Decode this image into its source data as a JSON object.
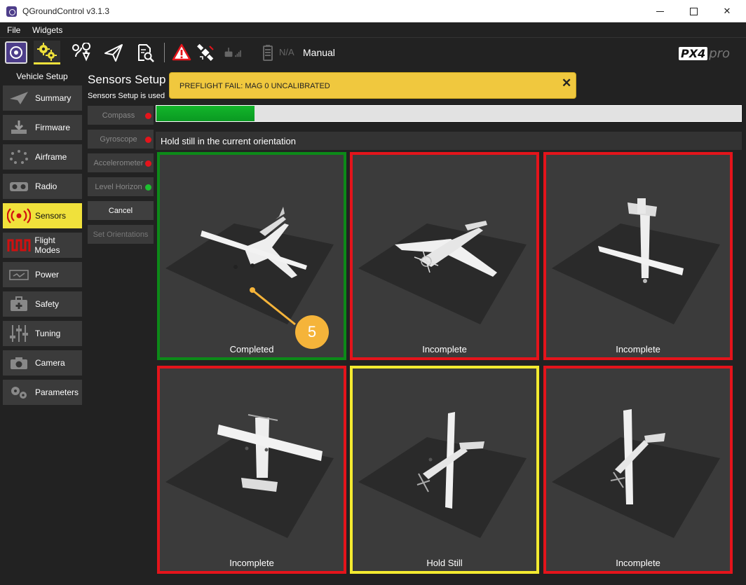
{
  "window": {
    "title": "QGroundControl v3.1.3"
  },
  "menu": {
    "file": "File",
    "widgets": "Widgets"
  },
  "toolbar": {
    "battery_text": "N/A",
    "flight_mode": "Manual",
    "brand_name": "PX4",
    "brand_suffix": "pro"
  },
  "sidebar": {
    "title": "Vehicle Setup",
    "items": [
      {
        "label": "Summary",
        "icon": "paper-plane-icon"
      },
      {
        "label": "Firmware",
        "icon": "download-icon"
      },
      {
        "label": "Airframe",
        "icon": "airframe-icon"
      },
      {
        "label": "Radio",
        "icon": "radio-icon"
      },
      {
        "label": "Sensors",
        "icon": "sensors-icon",
        "active": true
      },
      {
        "label": "Flight Modes",
        "icon": "flight-modes-icon"
      },
      {
        "label": "Power",
        "icon": "power-icon"
      },
      {
        "label": "Safety",
        "icon": "safety-icon"
      },
      {
        "label": "Tuning",
        "icon": "tuning-icon"
      },
      {
        "label": "Camera",
        "icon": "camera-icon"
      },
      {
        "label": "Parameters",
        "icon": "parameters-icon"
      }
    ]
  },
  "sensors": {
    "title": "Sensors Setup",
    "description": "Sensors Setup is used",
    "buttons": [
      {
        "label": "Compass",
        "status_color": "#e4141b"
      },
      {
        "label": "Gyroscope",
        "status_color": "#e4141b"
      },
      {
        "label": "Accelerometer",
        "status_color": "#e4141b"
      },
      {
        "label": "Level Horizon",
        "status_color": "#1ec030"
      }
    ],
    "cancel_label": "Cancel",
    "set_orientations_label": "Set Orientations"
  },
  "banner": {
    "message": "PREFLIGHT FAIL: MAG 0 UNCALIBRATED",
    "close": "✕"
  },
  "calibration": {
    "progress_fraction": 0.168,
    "instruction": "Hold still in the current orientation",
    "orientations": [
      {
        "status": "Completed",
        "state_color": "#0c8a18"
      },
      {
        "status": "Incomplete",
        "state_color": "#e4141b"
      },
      {
        "status": "Incomplete",
        "state_color": "#e4141b"
      },
      {
        "status": "Incomplete",
        "state_color": "#e4141b"
      },
      {
        "status": "Hold Still",
        "state_color": "#f3ea30"
      },
      {
        "status": "Incomplete",
        "state_color": "#e4141b"
      }
    ]
  },
  "callout": {
    "number": "5"
  },
  "colors": {
    "accent": "#f0e13b",
    "brand_purple": "#4d3d8a",
    "progress_green": "#13b52b",
    "callout_orange": "#f5b43a"
  }
}
